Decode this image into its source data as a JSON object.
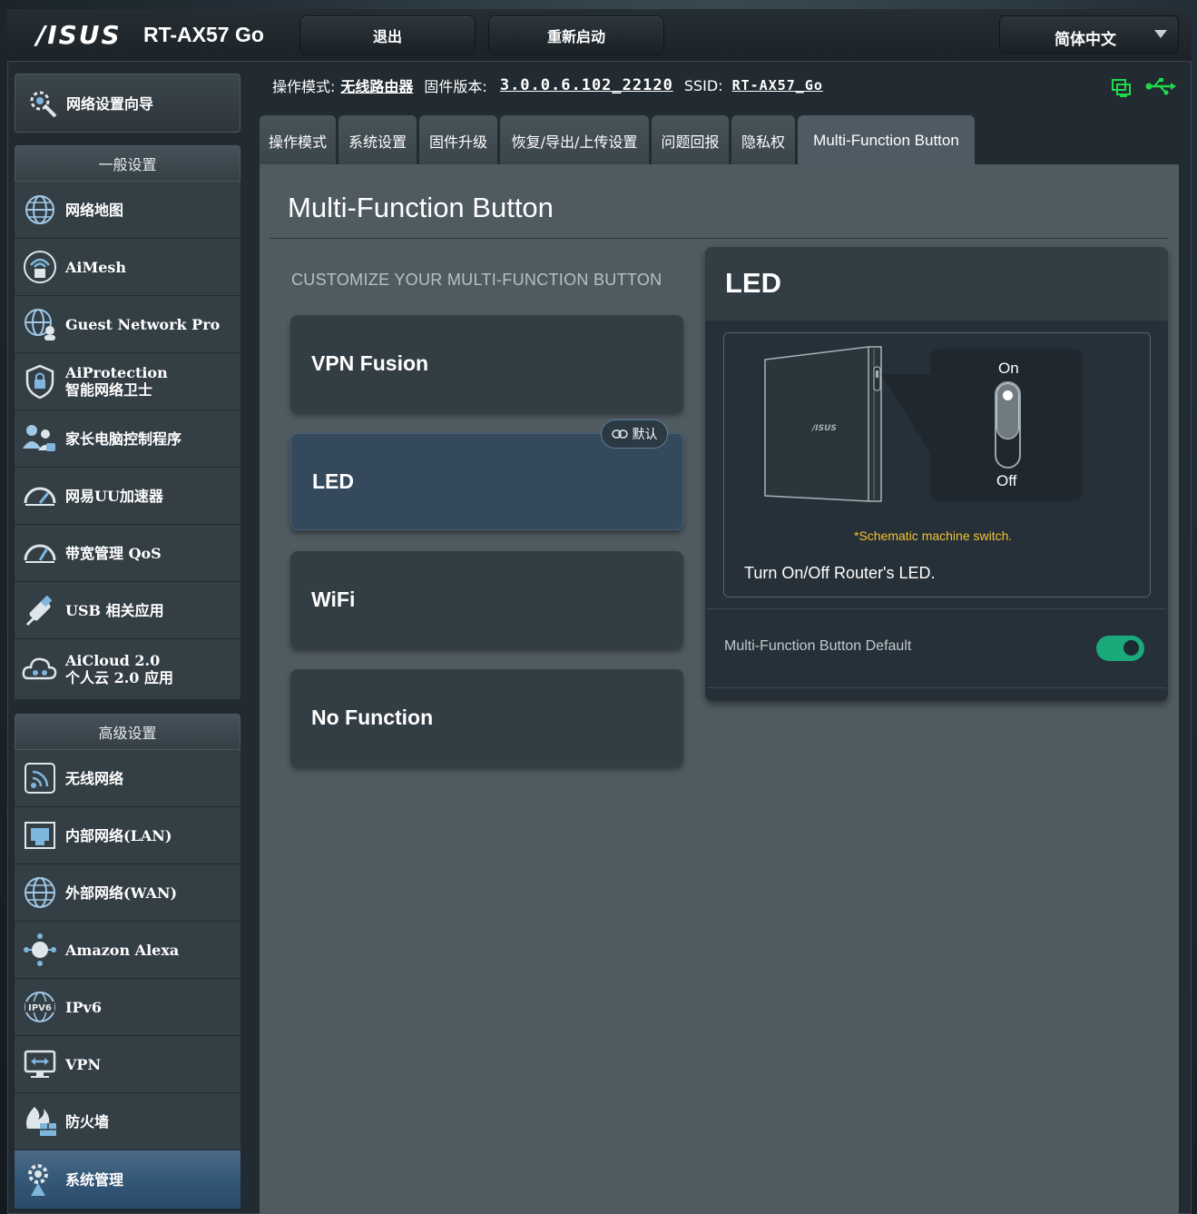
{
  "header": {
    "logo": "/ISUS",
    "model": "RT-AX57 Go",
    "logout_label": "退出",
    "reboot_label": "重新启动",
    "language": "简体中文"
  },
  "infobar": {
    "mode_label": "操作模式:",
    "mode_value": "无线路由器",
    "fw_label": "固件版本:",
    "fw_value": "3.0.0.6.102_22120",
    "ssid_label": "SSID:",
    "ssid_value": "RT-AX57_Go"
  },
  "sidebar": {
    "wizard": "网络设置向导",
    "general_header": "一般设置",
    "general_items": [
      {
        "label": "网络地图",
        "icon": "globe-network-icon"
      },
      {
        "label": "AiMesh",
        "icon": "aimesh-icon"
      },
      {
        "label": "Guest Network Pro",
        "icon": "guest-network-icon"
      },
      {
        "label": "AiProtection",
        "label2": "智能网络卫士",
        "icon": "shield-lock-icon"
      },
      {
        "label": "家长电脑控制程序",
        "icon": "parental-control-icon"
      },
      {
        "label": "网易UU加速器",
        "icon": "speedometer-icon"
      },
      {
        "label": "带宽管理 QoS",
        "icon": "qos-gauge-icon"
      },
      {
        "label": "USB 相关应用",
        "icon": "usb-icon"
      },
      {
        "label": "AiCloud 2.0",
        "label2": "个人云 2.0 应用",
        "icon": "cloud-icon"
      }
    ],
    "advanced_header": "高级设置",
    "advanced_items": [
      {
        "label": "无线网络",
        "icon": "wireless-icon"
      },
      {
        "label": "内部网络(LAN)",
        "icon": "lan-icon"
      },
      {
        "label": "外部网络(WAN)",
        "icon": "wan-globe-icon"
      },
      {
        "label": "Amazon Alexa",
        "icon": "alexa-icon"
      },
      {
        "label": "IPv6",
        "icon": "ipv6-icon"
      },
      {
        "label": "VPN",
        "icon": "vpn-icon"
      },
      {
        "label": "防火墙",
        "icon": "firewall-icon"
      },
      {
        "label": "系统管理",
        "icon": "system-admin-icon"
      }
    ]
  },
  "tabs": [
    {
      "label": "操作模式"
    },
    {
      "label": "系统设置"
    },
    {
      "label": "固件升级"
    },
    {
      "label": "恢复/导出/上传设置"
    },
    {
      "label": "问题回报"
    },
    {
      "label": "隐私权"
    },
    {
      "label": "Multi-Function Button"
    }
  ],
  "main": {
    "title": "Multi-Function Button",
    "subheading": "CUSTOMIZE YOUR MULTI-FUNCTION BUTTON",
    "options": [
      {
        "label": "VPN Fusion",
        "selected": false
      },
      {
        "label": "LED",
        "selected": true
      },
      {
        "label": "WiFi",
        "selected": false
      },
      {
        "label": "No Function",
        "selected": false
      }
    ],
    "default_badge": "默认"
  },
  "panel": {
    "title": "LED",
    "device_logo": "/ISUS",
    "switch_on": "On",
    "switch_off": "Off",
    "schematic_note": "*Schematic machine switch.",
    "description": "Turn On/Off Router's LED.",
    "default_label": "Multi-Function Button Default",
    "default_enabled": true
  },
  "colors": {
    "accent_green": "#19a97b",
    "note_yellow": "#f1c232",
    "active_menu": "#345878"
  }
}
